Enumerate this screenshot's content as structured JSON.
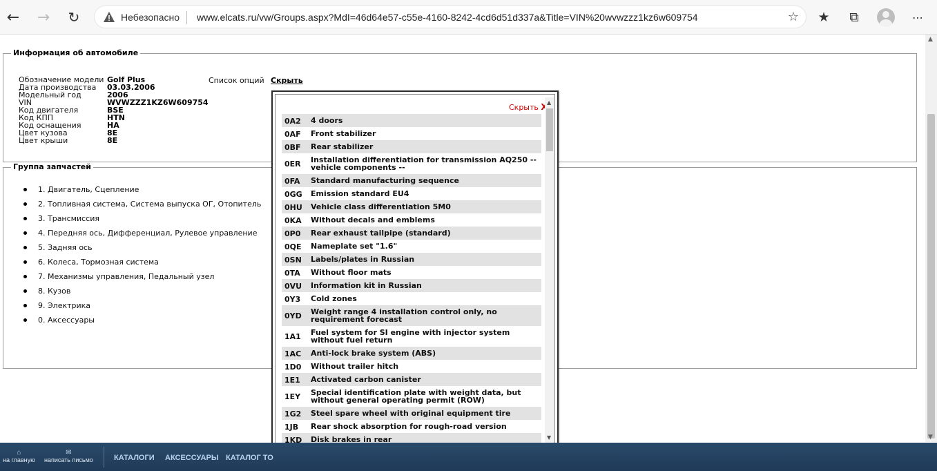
{
  "browser": {
    "insecure_label": "Небезопасно",
    "url": "www.elcats.ru/vw/Groups.aspx?MdI=46d64e57-c55e-4160-8242-4cd6d51d337a&Title=VIN%20wvwzzz1kz6w609754"
  },
  "vehicle_info": {
    "legend": "Информация об автомобиле",
    "rows": [
      {
        "label": "Обозначение модели",
        "value": "Golf Plus"
      },
      {
        "label": "Дата производства",
        "value": "03.03.2006"
      },
      {
        "label": "Модельный год",
        "value": "2006"
      },
      {
        "label": "VIN",
        "value": "WVWZZZ1KZ6W609754"
      },
      {
        "label": "Код двигателя",
        "value": "BSE"
      },
      {
        "label": "Код КПП",
        "value": "HTN"
      },
      {
        "label": "Код оснащения",
        "value": "HA"
      },
      {
        "label": "Цвет кузова",
        "value": "8E"
      },
      {
        "label": "Цвет крыши",
        "value": "8E"
      }
    ],
    "options_label": "Список опций",
    "options_toggle": "Скрыть"
  },
  "parts_group": {
    "legend": "Группа запчастей",
    "items": [
      "1. Двигатель, Сцепление",
      "2. Топливная система, Система выпуска ОГ, Отопитель",
      "3. Трансмиссия",
      "4. Передняя ось, Дифференциал, Рулевое управление",
      "5. Задняя ось",
      "6. Колеса, Тормозная система",
      "7. Механизмы управления, Педальный узел",
      "8. Кузов",
      "9. Электрика",
      "0. Аксессуары"
    ]
  },
  "options_popup": {
    "close_label": "Скрыть",
    "close_mark": "X",
    "options": [
      {
        "code": "0A2",
        "desc": "4 doors"
      },
      {
        "code": "0AF",
        "desc": "Front stabilizer"
      },
      {
        "code": "0BF",
        "desc": "Rear stabilizer"
      },
      {
        "code": "0ER",
        "desc": "Installation differentiation for transmission AQ250 -- vehicle components --"
      },
      {
        "code": "0FA",
        "desc": "Standard manufacturing sequence"
      },
      {
        "code": "0GG",
        "desc": "Emission standard EU4"
      },
      {
        "code": "0HU",
        "desc": "Vehicle class differentiation 5M0"
      },
      {
        "code": "0KA",
        "desc": "Without decals and emblems"
      },
      {
        "code": "0P0",
        "desc": "Rear exhaust tailpipe (standard)"
      },
      {
        "code": "0QE",
        "desc": "Nameplate set \"1.6\""
      },
      {
        "code": "0SN",
        "desc": "Labels/plates in Russian"
      },
      {
        "code": "0TA",
        "desc": "Without floor mats"
      },
      {
        "code": "0VU",
        "desc": "Information kit in Russian"
      },
      {
        "code": "0Y3",
        "desc": "Cold zones"
      },
      {
        "code": "0YD",
        "desc": "Weight range 4 installation control only, no requirement forecast"
      },
      {
        "code": "1A1",
        "desc": "Fuel system for SI engine with injector system without fuel return"
      },
      {
        "code": "1AC",
        "desc": "Anti-lock brake system (ABS)"
      },
      {
        "code": "1D0",
        "desc": "Without trailer hitch"
      },
      {
        "code": "1E1",
        "desc": "Activated carbon canister"
      },
      {
        "code": "1EY",
        "desc": "Special identification plate with weight data, but without general operating permit (ROW)"
      },
      {
        "code": "1G2",
        "desc": "Steel spare wheel with original equipment tire"
      },
      {
        "code": "1JB",
        "desc": "Rear shock absorption for rough-road version"
      },
      {
        "code": "1KD",
        "desc": "Disk brakes in rear"
      }
    ]
  },
  "footer": {
    "home_label": "на главную",
    "mail_label": "написать письмо",
    "links": [
      "КАТАЛОГИ",
      "АКСЕССУАРЫ",
      "КАТАЛОГ ТО"
    ]
  }
}
